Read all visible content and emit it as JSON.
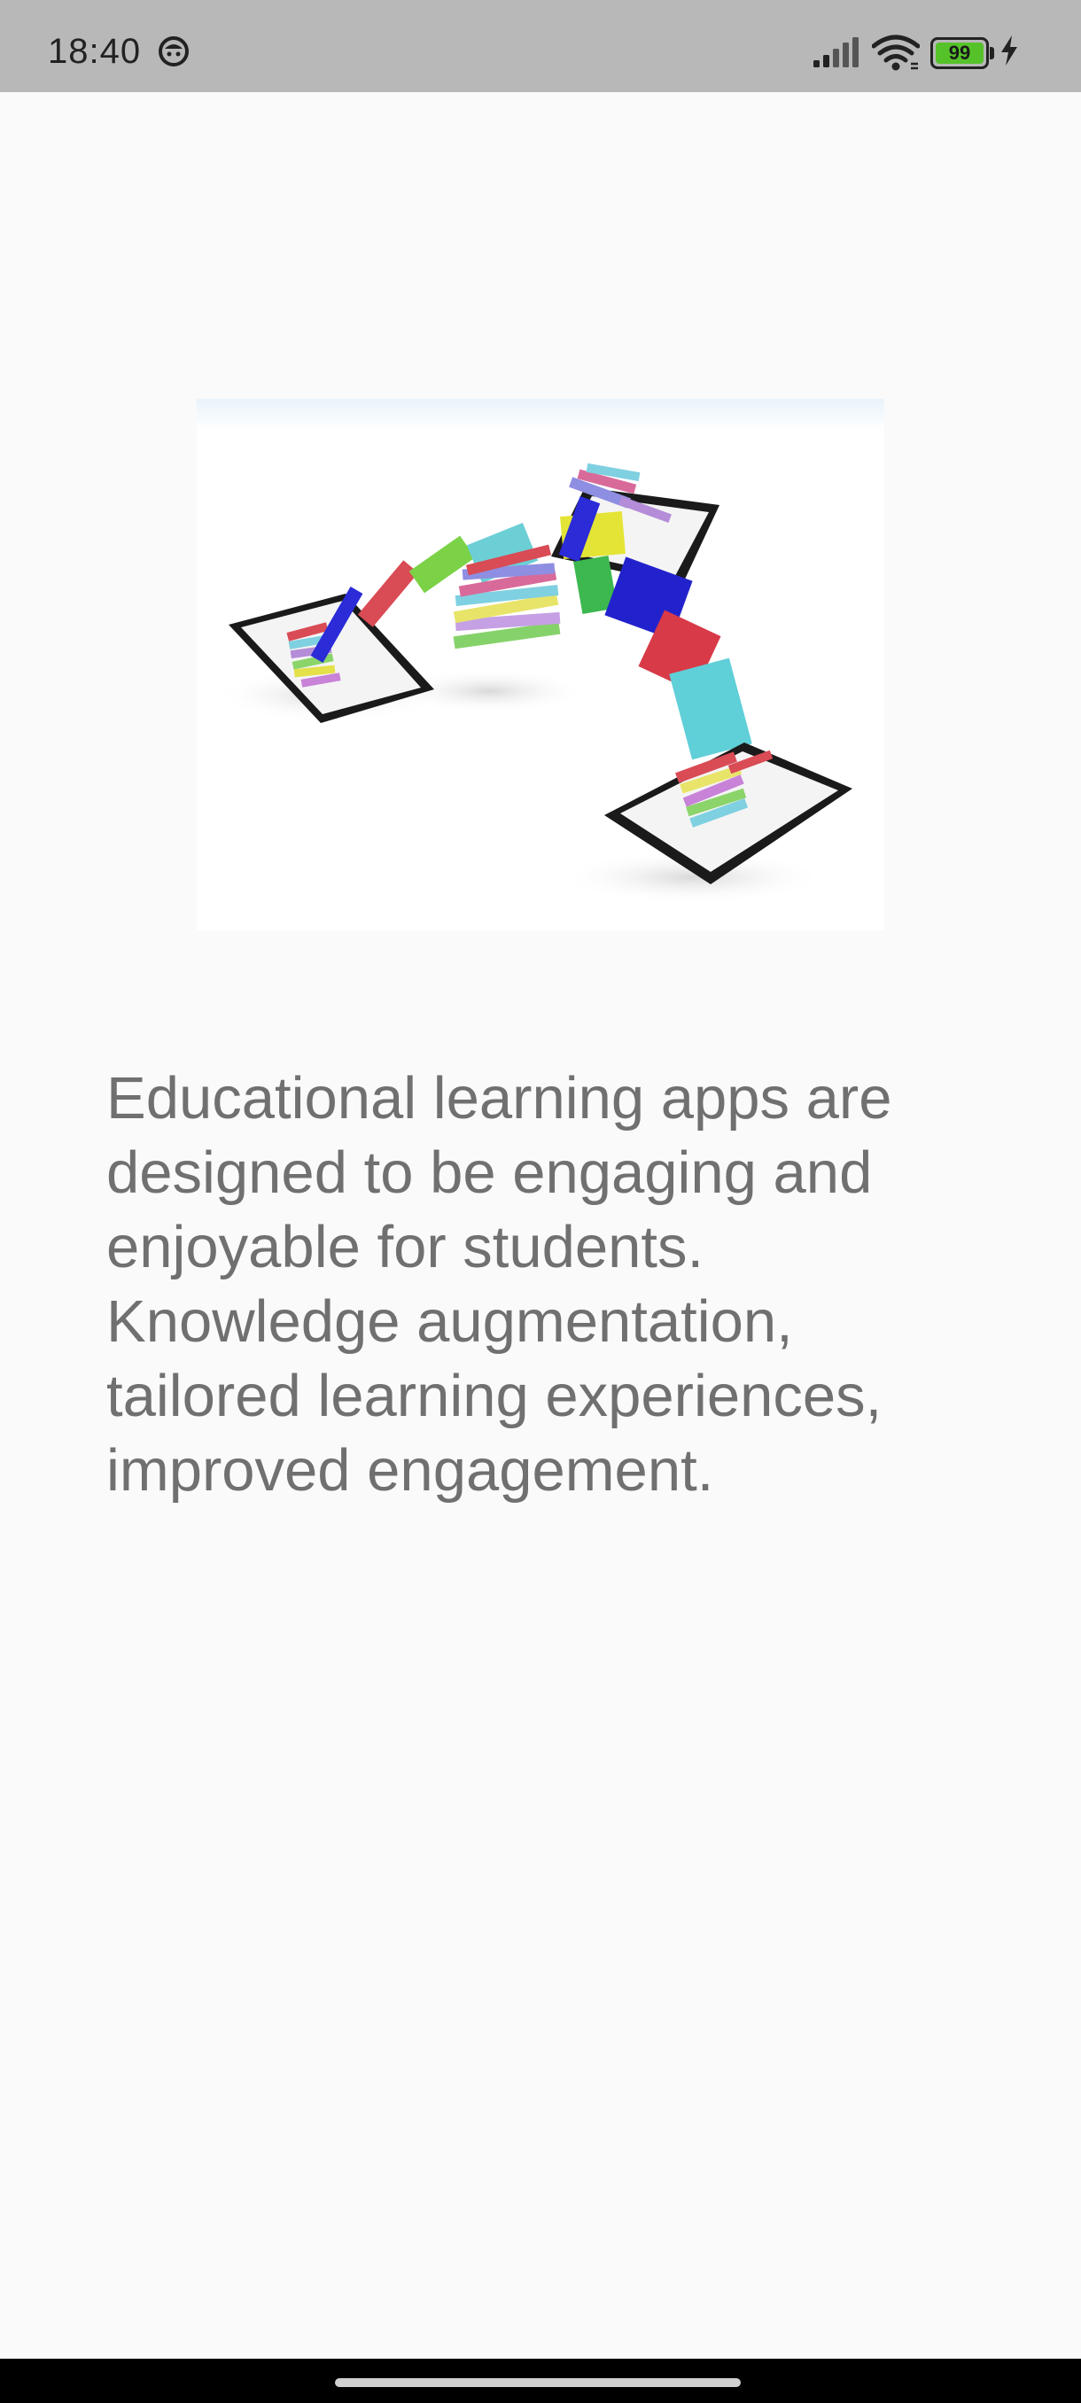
{
  "status_bar": {
    "time": "18:40",
    "battery_level": "99",
    "icons": [
      "app-notification-icon",
      "signal-icon",
      "wifi-icon",
      "battery-icon",
      "charging-icon"
    ]
  },
  "onboarding": {
    "image": "educational-books-tablets-illustration",
    "description": "Educational learning apps are designed to be engaging and enjoyable for students. Knowledge augmentation, tailored learning experiences, improved engagement."
  },
  "colors": {
    "status_bar_bg": "#b8b8b8",
    "page_bg": "#fafafa",
    "text": "#707070",
    "battery": "#56c22a"
  }
}
